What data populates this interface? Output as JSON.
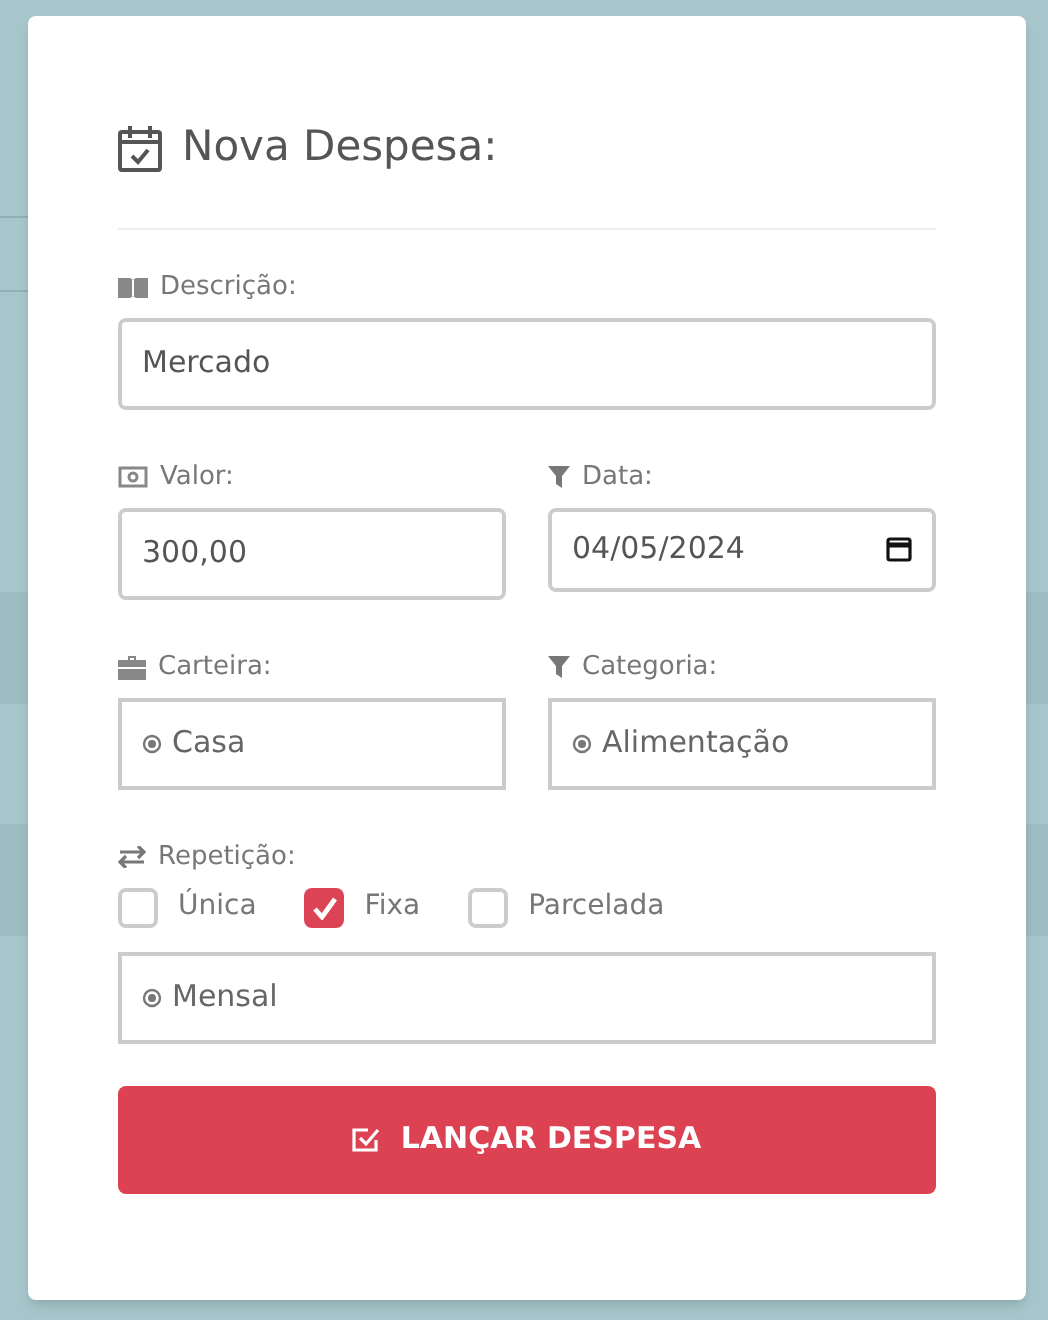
{
  "modal": {
    "title": "Nova Despesa:",
    "description": {
      "label": "Descrição:",
      "value": "Mercado"
    },
    "amount": {
      "label": "Valor:",
      "value": "300,00"
    },
    "date": {
      "label": "Data:",
      "value": "04/05/2024"
    },
    "wallet": {
      "label": "Carteira:",
      "value": "Casa"
    },
    "category": {
      "label": "Categoria:",
      "value": "Alimentação"
    },
    "repetition": {
      "label": "Repetição:",
      "options": [
        {
          "label": "Única",
          "checked": false
        },
        {
          "label": "Fixa",
          "checked": true
        },
        {
          "label": "Parcelada",
          "checked": false
        }
      ]
    },
    "frequency": {
      "value": "Mensal"
    },
    "submit": {
      "label": "LANÇAR DESPESA"
    }
  }
}
